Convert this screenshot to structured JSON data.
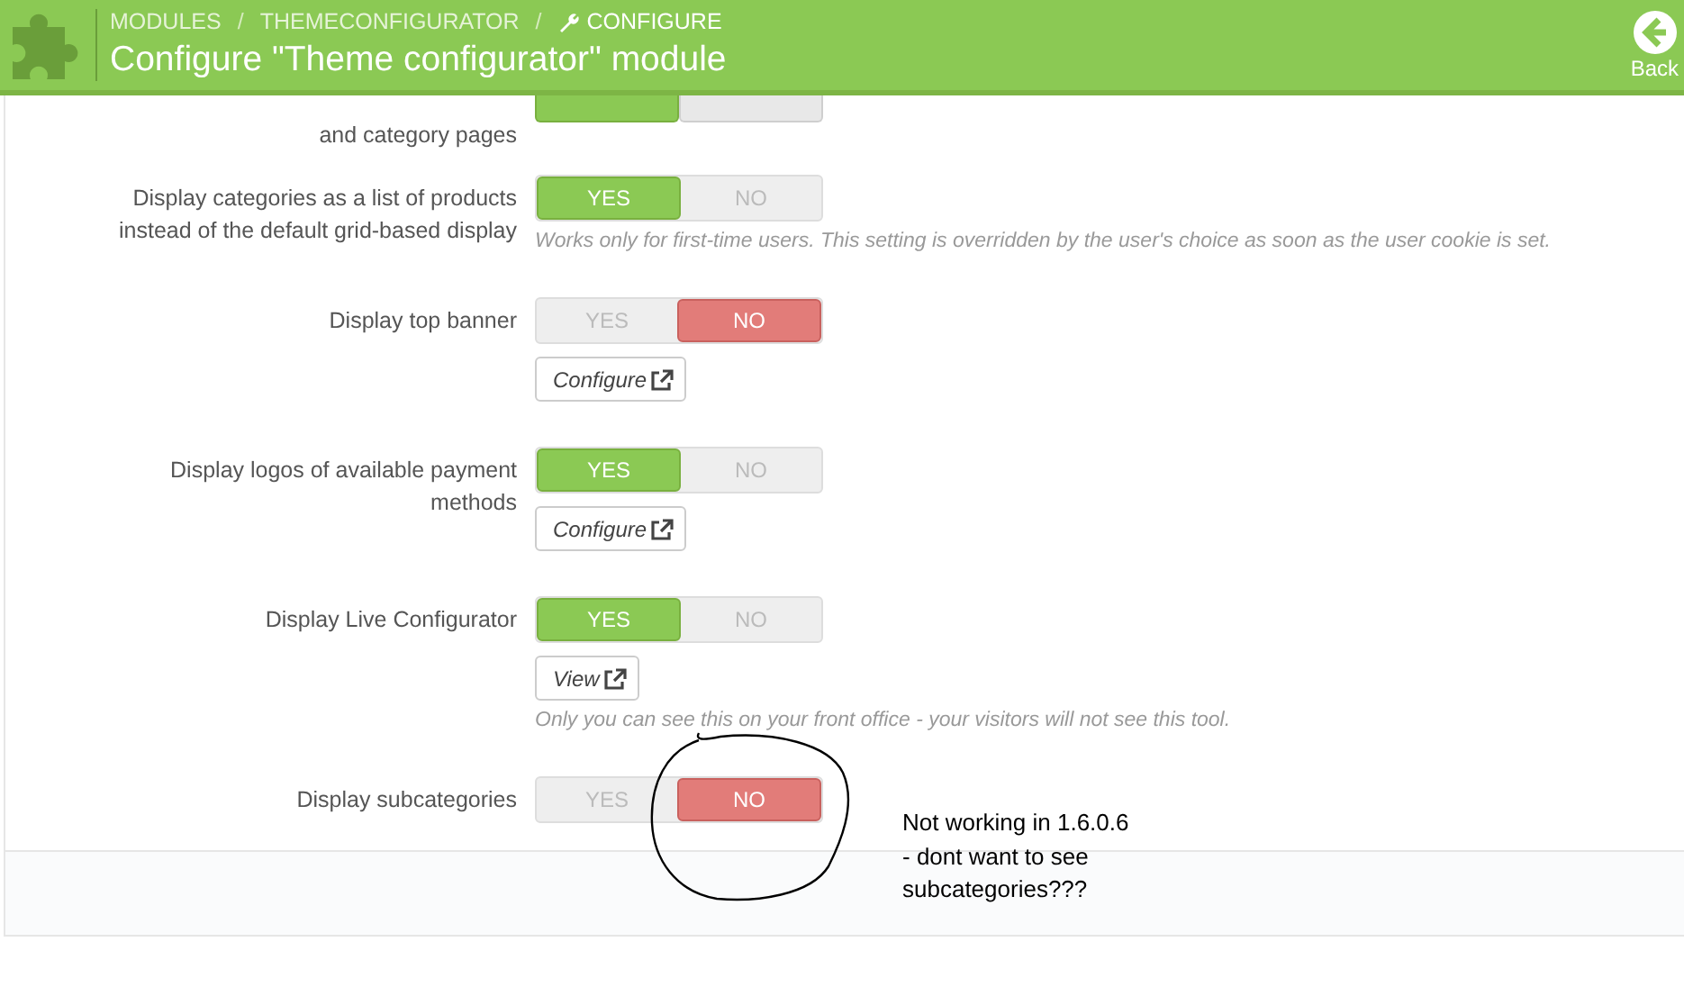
{
  "header": {
    "breadcrumb": [
      {
        "label": "MODULES"
      },
      {
        "label": "THEMECONFIGURATOR"
      },
      {
        "label": "CONFIGURE"
      }
    ],
    "separator": "/",
    "title": "Configure \"Theme configurator\" module",
    "back_label": "Back"
  },
  "settings": [
    {
      "label_lines": [
        "and category pages"
      ],
      "options": [
        {
          "selected": true
        },
        {
          "selected": false
        }
      ]
    },
    {
      "label_lines": [
        "Display categories as a list of products",
        "instead of the default grid-based display"
      ],
      "options": [
        {
          "label": "YES",
          "selected": true
        },
        {
          "label": "NO",
          "selected": false
        }
      ],
      "help": "Works only for first-time users. This setting is overridden by the user's choice as soon as the user cookie is set."
    },
    {
      "label_lines": [
        "Display top banner"
      ],
      "options": [
        {
          "label": "YES",
          "selected": false
        },
        {
          "label": "NO",
          "selected": true
        }
      ],
      "button": "Configure"
    },
    {
      "label_lines": [
        "Display logos of available payment",
        "methods"
      ],
      "options": [
        {
          "label": "YES",
          "selected": true
        },
        {
          "label": "NO",
          "selected": false
        }
      ],
      "button": "Configure"
    },
    {
      "label_lines": [
        "Display Live Configurator"
      ],
      "options": [
        {
          "label": "YES",
          "selected": true
        },
        {
          "label": "NO",
          "selected": false
        }
      ],
      "button": "View",
      "help": "Only you can see this on your front office - your visitors will not see this tool."
    },
    {
      "label_lines": [
        "Display subcategories"
      ],
      "options": [
        {
          "label": "YES",
          "selected": false
        },
        {
          "label": "NO",
          "selected": true
        }
      ]
    }
  ],
  "annotation": {
    "lines": [
      "Not working in 1.6.0.6",
      "- dont want to see",
      "subcategories???"
    ]
  }
}
